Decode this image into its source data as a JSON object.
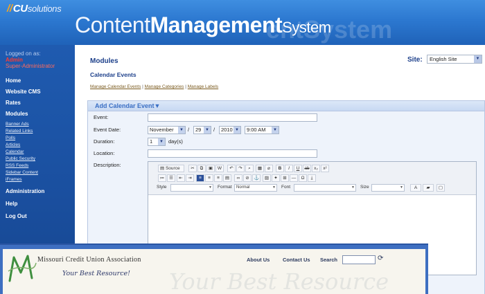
{
  "header": {
    "logo_main": "CU",
    "logo_sub": "solutions",
    "title_thin": "Content",
    "title_bold": "Management",
    "title_small": "System",
    "title_ghost": "entSystem"
  },
  "sidebar": {
    "logged_label": "Logged on as:",
    "user_name": "Admin",
    "user_role": "Super-Administrator",
    "nav": [
      {
        "label": "Home"
      },
      {
        "label": "Website CMS"
      },
      {
        "label": "Rates"
      },
      {
        "label": "Modules"
      }
    ],
    "module_links": [
      {
        "label": "Banner Ads"
      },
      {
        "label": "Related Links"
      },
      {
        "label": "Polls"
      },
      {
        "label": "Articles"
      },
      {
        "label": "Calendar"
      },
      {
        "label": "Public Security"
      },
      {
        "label": "RSS Feeds"
      },
      {
        "label": "Sidebar Content"
      },
      {
        "label": "iFrames"
      }
    ],
    "nav_bottom": [
      {
        "label": "Administration"
      },
      {
        "label": "Help"
      },
      {
        "label": "Log Out"
      }
    ]
  },
  "main": {
    "page_title": "Modules",
    "site_label": "Site:",
    "site_value": "English Site",
    "section_title": "Calendar Events",
    "links": [
      "Manage Calendar Events",
      "Manage Categories",
      "Manage Labels"
    ],
    "link_sep": " | "
  },
  "form": {
    "title": "Add Calendar Event",
    "title_arrow": "▼",
    "event_label": "Event:",
    "date_label": "Event Date:",
    "month": "November",
    "day": "29",
    "year": "2010",
    "time": "9:00 AM",
    "duration_label": "Duration:",
    "duration_value": "1",
    "duration_unit": "day(s)",
    "location_label": "Location:",
    "description_label": "Description:"
  },
  "editor": {
    "source_label": "Source",
    "style_label": "Style",
    "format_label": "Format",
    "format_value": "Normal",
    "font_label": "Font",
    "size_label": "Size"
  },
  "mcua": {
    "name": "Missouri Credit Union Association",
    "tagline": "Your Best Resource!",
    "ghost": "Your Best Resource",
    "nav": [
      "About Us",
      "Contact Us",
      "Search"
    ]
  }
}
